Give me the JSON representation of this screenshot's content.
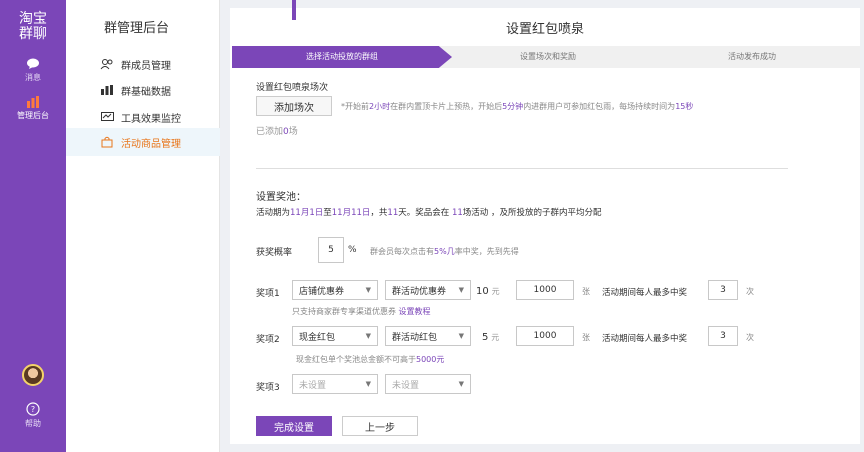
{
  "brand": {
    "line1": "淘宝",
    "line2": "群聊"
  },
  "rail": [
    {
      "label": "消息"
    },
    {
      "label": "管理后台"
    },
    {
      "label": "帮助"
    }
  ],
  "sidebar": {
    "title": "群管理后台",
    "items": [
      {
        "label": "群成员管理"
      },
      {
        "label": "群基础数据"
      },
      {
        "label": "工具效果监控"
      },
      {
        "label": "活动商品管理"
      }
    ]
  },
  "page": {
    "title": "设置红包喷泉",
    "steps": [
      "选择活动投放的群组",
      "设置场次和奖励",
      "活动发布成功"
    ]
  },
  "session": {
    "label": "设置红包喷泉场次",
    "add_button": "添加场次",
    "hint_parts": [
      "*开始前",
      "2小时",
      "在群内置顶卡片上预热，开始后",
      "5分钟",
      "内进群用户可参加红包雨，每场持续时间为",
      "15秒"
    ],
    "added_parts": [
      "已添加",
      "0",
      "场"
    ]
  },
  "pool": {
    "label": "设置奖池：",
    "period_parts": [
      "活动期为",
      "11月1日",
      "至",
      "11月11日",
      "，共",
      "11",
      "天。奖品会在 ",
      "11",
      "场活动 ，及所投放的子群内平均分配"
    ],
    "prob_label": "获奖概率",
    "prob_value": "5",
    "prob_unit": "%",
    "prob_hint_parts": [
      "群会员每次点击有",
      "5%几",
      "率中奖，先到先得"
    ]
  },
  "prizes": [
    {
      "label": "奖项1",
      "type": "店铺优惠券",
      "subtype": "群活动优惠券",
      "amount": "10",
      "amount_unit": "元",
      "qty": "1000",
      "qty_unit": "张",
      "limit_label": "活动期间每人最多中奖",
      "limit": "3",
      "limit_unit": "次",
      "note": "只支持商家群专享渠道优惠券",
      "link": "设置教程"
    },
    {
      "label": "奖项2",
      "type": "现金红包",
      "subtype": "群活动红包",
      "amount": "5",
      "amount_unit": "元",
      "qty": "1000",
      "qty_unit": "张",
      "limit_label": "活动期间每人最多中奖",
      "limit": "3",
      "limit_unit": "次",
      "note_parts": [
        "现金红包单个奖池总金额不可高于",
        "5000元"
      ]
    },
    {
      "label": "奖项3",
      "type": "未设置",
      "subtype": "未设置"
    }
  ],
  "footer": {
    "finish_button": "完成设置",
    "prev_button": "上一步"
  },
  "colors": {
    "accent": "#7b46b8",
    "orange": "#e8751a"
  }
}
